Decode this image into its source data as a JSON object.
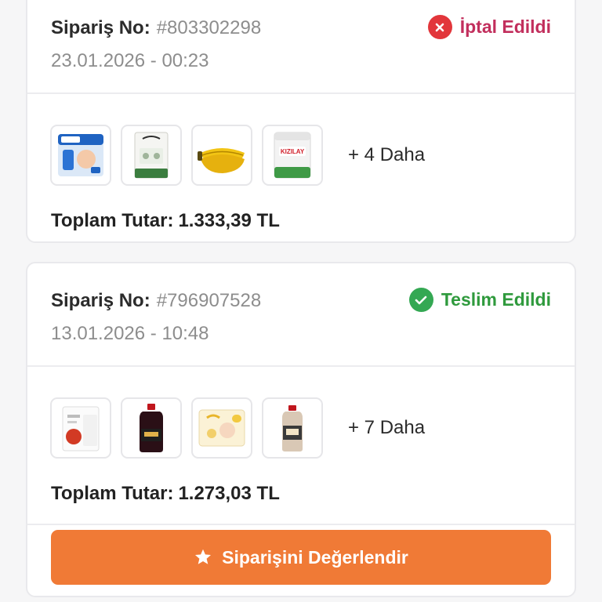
{
  "orders": [
    {
      "order_label": "Sipariş No:",
      "order_number": "#803302298",
      "date": "23.01.2026 - 00:23",
      "status": {
        "label": "İptal Edildi",
        "icon": "close-circle-icon",
        "color": "#c22f5d",
        "badge_color": "#e2363b"
      },
      "products": [
        {
          "icon": "diaper-pack-icon"
        },
        {
          "icon": "sleepy-wipes-pack-icon"
        },
        {
          "icon": "banana-icon"
        },
        {
          "icon": "kizilay-product-pack-icon"
        }
      ],
      "more_label": "+ 4 Daha",
      "total_label": "Toplam Tutar:",
      "total_value": "1.333,39 TL"
    },
    {
      "order_label": "Sipariş No:",
      "order_number": "#796907528",
      "date": "13.01.2026 - 10:48",
      "status": {
        "label": "Teslim Edildi",
        "icon": "check-circle-icon",
        "color": "#2f9a3d",
        "badge_color": "#34a853"
      },
      "products": [
        {
          "icon": "bags-pack-icon"
        },
        {
          "icon": "dark-sauce-bottle-icon"
        },
        {
          "icon": "sleepy-wipes-yellow-pack-icon"
        },
        {
          "icon": "milk-bottle-icon"
        }
      ],
      "more_label": "+ 7 Daha",
      "total_label": "Toplam Tutar:",
      "total_value": "1.273,03 TL",
      "action": {
        "label": "Siparişini Değerlendir",
        "icon": "star-icon",
        "color": "#f07a36"
      }
    }
  ]
}
